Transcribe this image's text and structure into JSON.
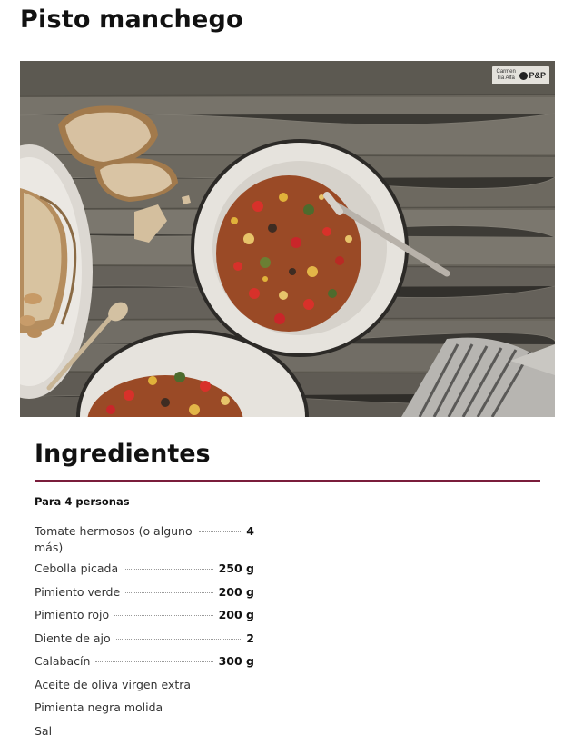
{
  "recipe": {
    "title": "Pisto manchego"
  },
  "photo": {
    "watermark_text": "Carmen Tía Alfa",
    "watermark_badge": "P&P"
  },
  "ingredients": {
    "heading": "Ingredientes",
    "servings": "Para 4 personas",
    "items": [
      {
        "name": "Tomate hermosos (o alguno más)",
        "qty": "4"
      },
      {
        "name": "Cebolla picada",
        "qty": "250 g"
      },
      {
        "name": "Pimiento verde",
        "qty": "200 g"
      },
      {
        "name": "Pimiento rojo",
        "qty": "200 g"
      },
      {
        "name": "Diente de ajo",
        "qty": "2"
      },
      {
        "name": "Calabacín",
        "qty": "300 g"
      },
      {
        "name": "Aceite de oliva virgen extra",
        "qty": ""
      },
      {
        "name": "Pimienta negra molida",
        "qty": ""
      },
      {
        "name": "Sal",
        "qty": ""
      }
    ]
  },
  "colors": {
    "accent_rule": "#7a1d3b",
    "text": "#111111"
  }
}
